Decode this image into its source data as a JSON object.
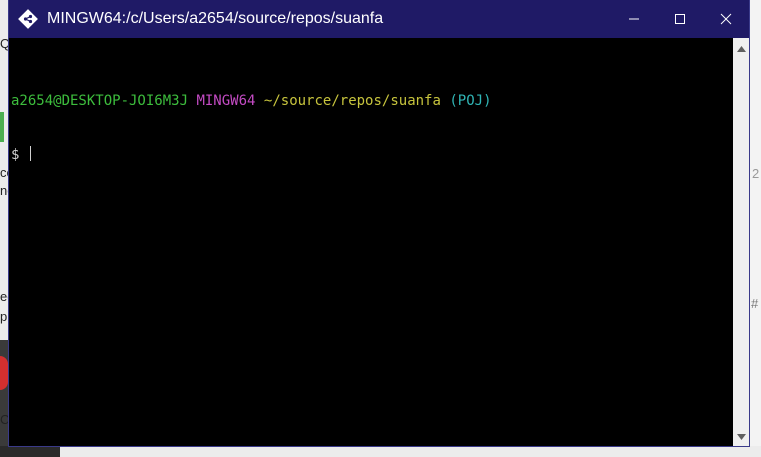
{
  "window": {
    "title": "MINGW64:/c/Users/a2654/source/repos/suanfa",
    "titlebar_color": "#1f1a66"
  },
  "controls": {
    "minimize_icon": "minimize-icon",
    "maximize_icon": "maximize-icon",
    "close_icon": "close-icon"
  },
  "terminal": {
    "prompt_user_host": "a2654@DESKTOP-JOI6M3J",
    "prompt_system": "MINGW64",
    "prompt_path": "~/source/repos/suanfa",
    "prompt_branch": "(POJ)",
    "prompt_symbol": "$",
    "colors": {
      "user_host": "#3dbd3d",
      "system": "#c44bc4",
      "path": "#c7c43d",
      "branch": "#30b5b5"
    }
  },
  "background": {
    "fragments": [
      "Q",
      "ce",
      "no",
      "ec",
      "p",
      "C",
      "2",
      "#"
    ]
  }
}
